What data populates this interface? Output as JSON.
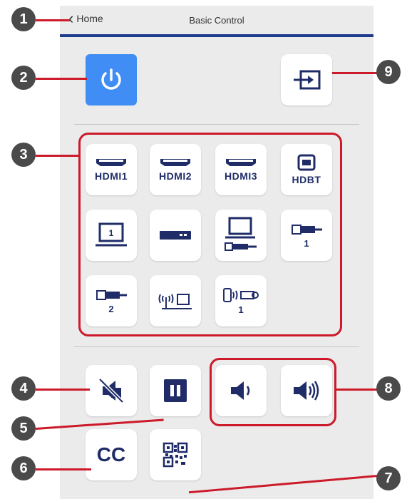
{
  "header": {
    "back_label": "Home",
    "title": "Basic Control"
  },
  "power": {
    "icon": "power-icon",
    "color": "#3f8df5"
  },
  "source_search": {
    "icon": "source-search-icon"
  },
  "sources": [
    {
      "label": "HDMI1",
      "icon": "hdmi-icon"
    },
    {
      "label": "HDMI2",
      "icon": "hdmi-icon"
    },
    {
      "label": "HDMI3",
      "icon": "hdmi-icon"
    },
    {
      "label": "HDBT",
      "icon": "hdbaset-icon"
    },
    {
      "label": "1",
      "icon": "computer-icon"
    },
    {
      "label": "",
      "icon": "video-player-icon"
    },
    {
      "label": "",
      "icon": "laptop-usb-icon"
    },
    {
      "label": "1",
      "icon": "usb-icon"
    },
    {
      "label": "2",
      "icon": "usb-icon"
    },
    {
      "label": "",
      "icon": "network-icon"
    },
    {
      "label": "1",
      "icon": "screen-mirroring-icon"
    }
  ],
  "controls": {
    "av_mute_icon": "av-mute-icon",
    "freeze_icon": "freeze-icon",
    "volume_down_icon": "volume-down-icon",
    "volume_up_icon": "volume-up-icon",
    "cc_label": "CC",
    "qr_icon": "qr-code-icon"
  },
  "callouts": [
    "1",
    "2",
    "3",
    "4",
    "5",
    "6",
    "7",
    "8",
    "9"
  ],
  "colors": {
    "accent_blue": "#3f8df5",
    "icon_navy": "#1f2c68",
    "outline_red": "#cc1a2a",
    "callout_grey": "#4a4a4a"
  }
}
